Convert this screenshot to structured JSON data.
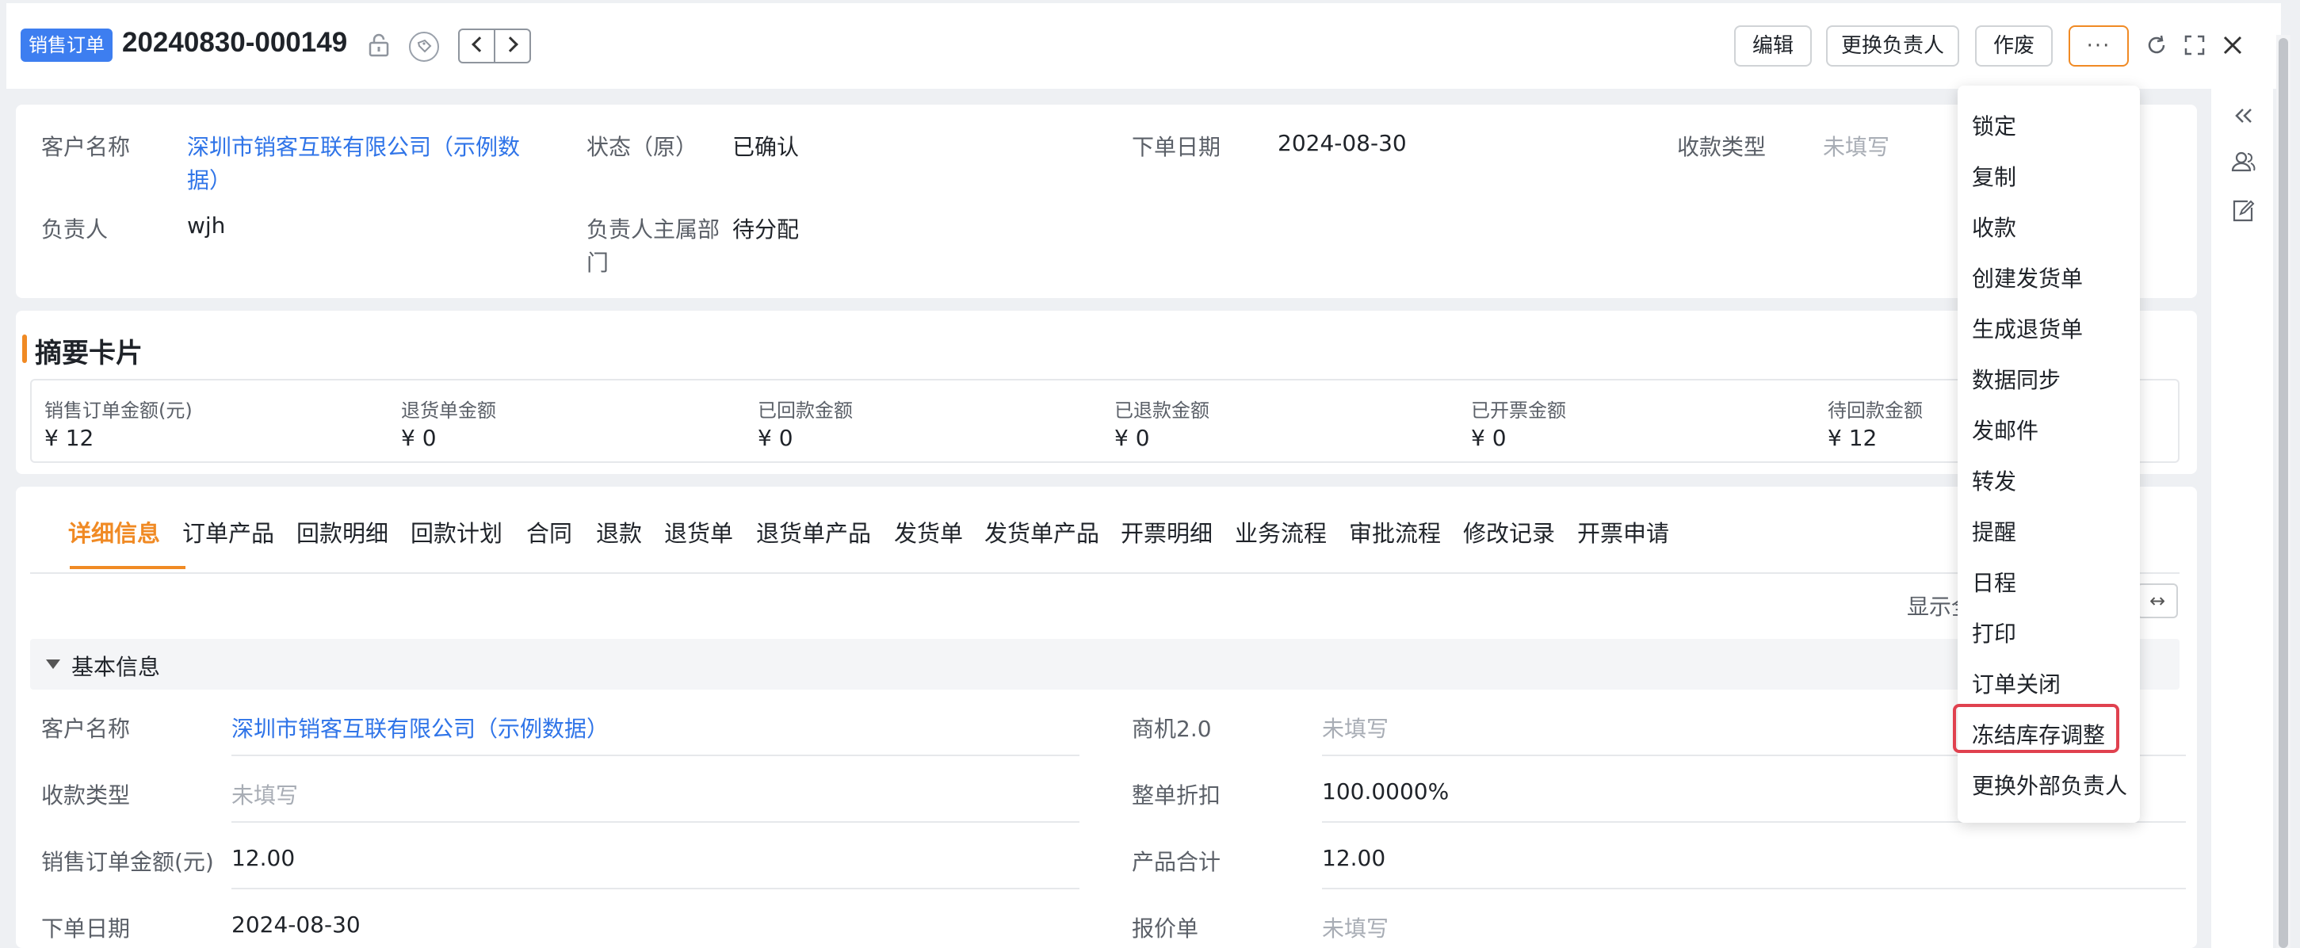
{
  "header": {
    "badge": "销售订单",
    "order_no": "20240830-000149",
    "buttons": {
      "edit": "编辑",
      "change_owner": "更换负责人",
      "void": "作废",
      "more": "···"
    }
  },
  "info": {
    "customer_label": "客户名称",
    "customer_value_line1": "深圳市销客互联有限公司（示例数",
    "customer_value_line2": "据）",
    "status_label": "状态（原）",
    "status_value": "已确认",
    "order_date_label": "下单日期",
    "order_date_value": "2024-08-30",
    "payment_type_label": "收款类型",
    "payment_type_value": "未填写",
    "owner_label": "负责人",
    "owner_value": "wjh",
    "owner_dept_label_line1": "负责人主属部",
    "owner_dept_label_line2": "门",
    "owner_dept_value": "待分配"
  },
  "summary": {
    "title": "摘要卡片",
    "items": [
      {
        "label": "销售订单金额(元)",
        "value": "¥ 12"
      },
      {
        "label": "退货单金额",
        "value": "¥ 0"
      },
      {
        "label": "已回款金额",
        "value": "¥ 0"
      },
      {
        "label": "已退款金额",
        "value": "¥ 0"
      },
      {
        "label": "已开票金额",
        "value": "¥ 0"
      },
      {
        "label": "待回款金额",
        "value": "¥ 12"
      }
    ]
  },
  "tabs": [
    "详细信息",
    "订单产品",
    "回款明细",
    "回款计划",
    "合同",
    "退款",
    "退货单",
    "退货单产品",
    "发货单",
    "发货单产品",
    "开票明细",
    "业务流程",
    "审批流程",
    "修改记录",
    "开票申请"
  ],
  "detail": {
    "show_text": "显示全",
    "expand_icon": "↔",
    "section_title": "基本信息",
    "left_fields": [
      {
        "label": "客户名称",
        "value": "深圳市销客互联有限公司（示例数据）"
      },
      {
        "label": "收款类型",
        "value": "未填写"
      },
      {
        "label": "销售订单金额(元)",
        "value": "12.00"
      },
      {
        "label": "下单日期",
        "value": "2024-08-30"
      }
    ],
    "right_fields": [
      {
        "label": "商机2.0",
        "value": "未填写"
      },
      {
        "label": "整单折扣",
        "value": "100.0000%"
      },
      {
        "label": "产品合计",
        "value": "12.00"
      },
      {
        "label": "报价单",
        "value": "未填写"
      }
    ]
  },
  "dropdown": {
    "items": [
      "锁定",
      "复制",
      "收款",
      "创建发货单",
      "生成退货单",
      "数据同步",
      "发邮件",
      "转发",
      "提醒",
      "日程",
      "打印",
      "订单关闭",
      "冻结库存调整",
      "更换外部负责人"
    ],
    "highlighted": "冻结库存调整"
  },
  "icons": [
    "lock-icon",
    "tag-icon",
    "chevron-left-icon",
    "chevron-right-icon",
    "refresh-icon",
    "fullscreen-icon",
    "close-icon",
    "collapse-icon",
    "team-icon",
    "edit-note-icon",
    "caret-down-icon"
  ],
  "colors": {
    "accent": "#f08a24",
    "link": "#2f74e8",
    "badge": "#3d7ef0",
    "highlight": "#e0414f"
  }
}
